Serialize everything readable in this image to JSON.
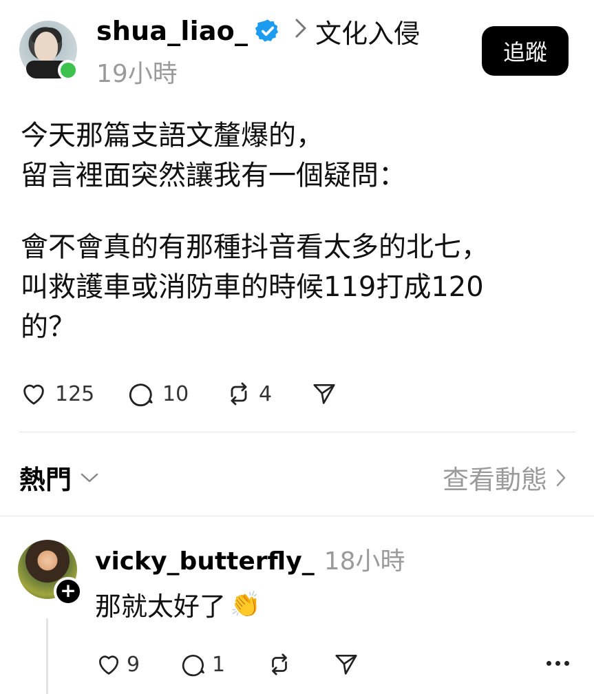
{
  "post": {
    "username": "shua_liao_",
    "topic": "文化入侵",
    "time": "19小時",
    "follow_label": "追蹤",
    "paragraphs": [
      "今天那篇支語文釐爆的，\n留言裡面突然讓我有一個疑問：",
      "會不會真的有那種抖音看太多的北七，\n叫救護車或消防車的時候119打成120\n的？"
    ],
    "actions": {
      "likes": "125",
      "comments": "10",
      "reposts": "4"
    }
  },
  "replies_bar": {
    "sort_label": "熱門",
    "activity_label": "查看動態"
  },
  "comment": {
    "username": "vicky_butterfly_",
    "time": "18小時",
    "text": "那就太好了",
    "emoji": "👏",
    "actions": {
      "likes": "9",
      "comments": "1"
    }
  },
  "colors": {
    "verified": "#1d9bf0",
    "online": "#3cc14f",
    "follow_bg": "#000000"
  }
}
